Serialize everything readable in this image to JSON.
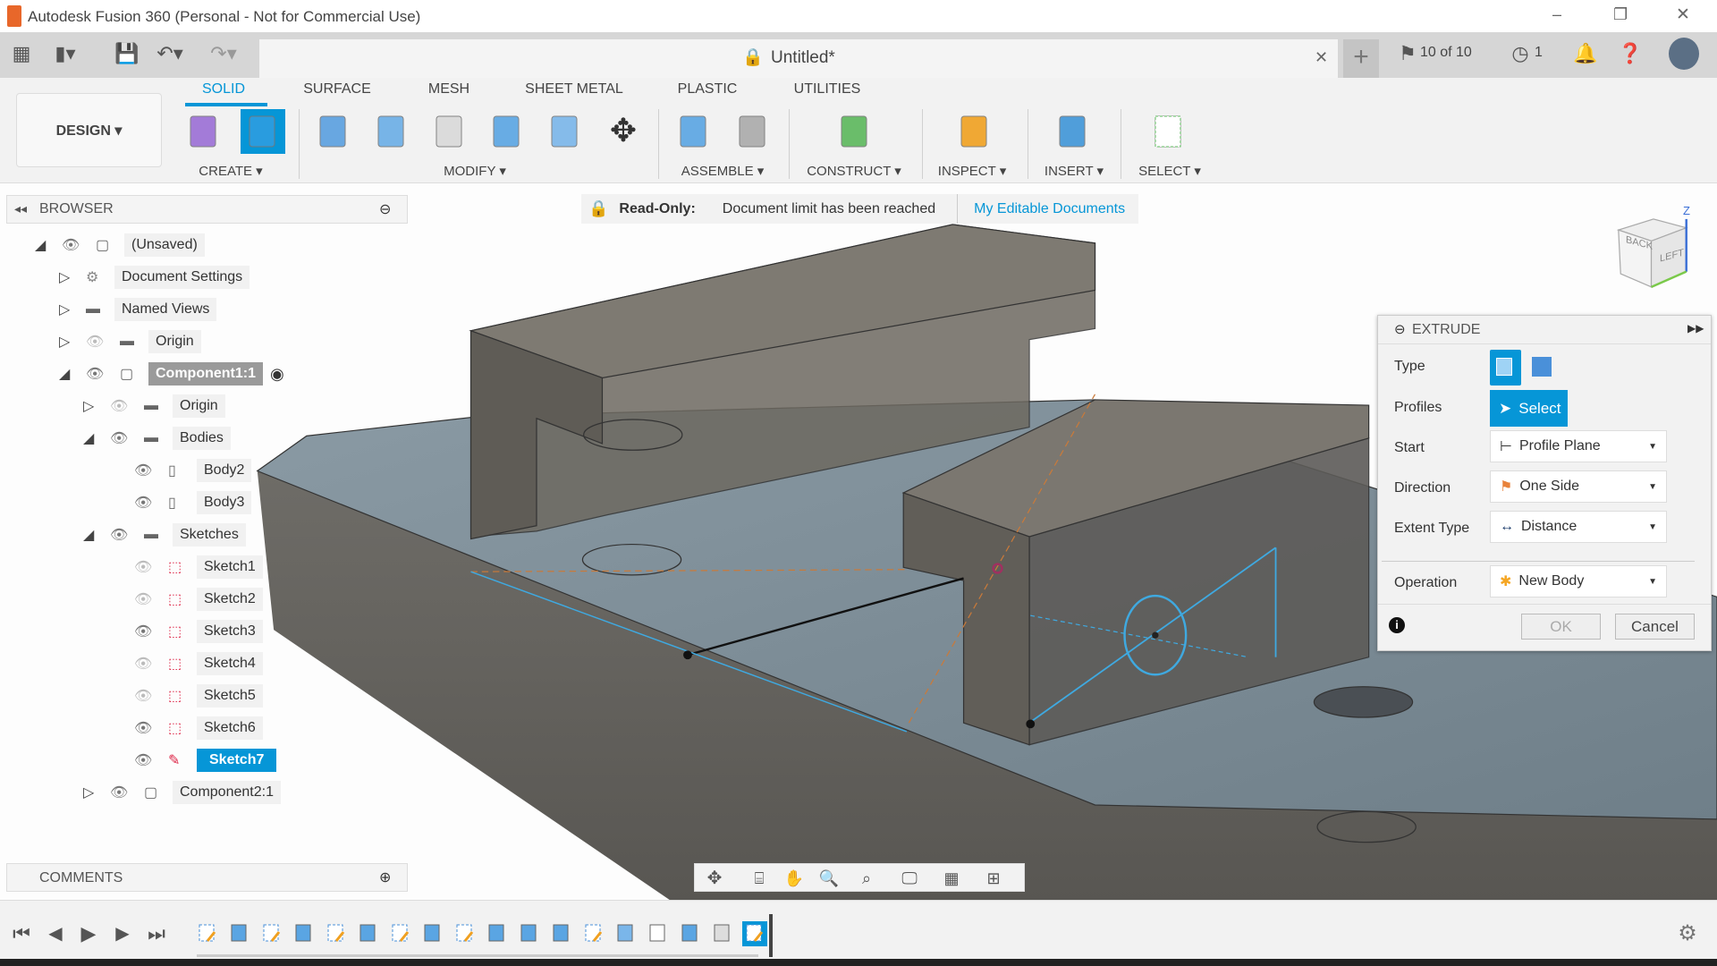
{
  "window": {
    "title": "Autodesk Fusion 360 (Personal - Not for Commercial Use)",
    "minimize": "–",
    "maximize": "❐",
    "close": "✕"
  },
  "tabbar": {
    "doc_title": "Untitled*",
    "close": "✕",
    "plus": "+",
    "jobs": "10 of 10",
    "clock_count": "1"
  },
  "toolbar": {
    "workspace": "DESIGN ▾",
    "tabs": [
      "SOLID",
      "SURFACE",
      "MESH",
      "SHEET METAL",
      "PLASTIC",
      "UTILITIES"
    ],
    "active_tab": "SOLID",
    "groups": [
      "CREATE ▾",
      "MODIFY ▾",
      "ASSEMBLE ▾",
      "CONSTRUCT ▾",
      "INSPECT ▾",
      "INSERT ▾",
      "SELECT ▾"
    ],
    "icons": [
      "create-component-icon",
      "extrude-icon",
      "press-pull-icon",
      "fillet-icon",
      "shell-icon",
      "combine-icon",
      "split-face-icon",
      "move-icon",
      "new-component-icon",
      "joint-icon",
      "offset-plane-icon",
      "measure-icon",
      "insert-image-icon",
      "select-window-icon"
    ]
  },
  "banner": {
    "label": "Read-Only:",
    "message": "Document limit has been reached",
    "link": "My Editable Documents"
  },
  "browser": {
    "title": "BROWSER",
    "items": [
      {
        "label": "(Unsaved)",
        "level": 0,
        "toggle": "open",
        "eye": "on",
        "icon": "document"
      },
      {
        "label": "Document Settings",
        "level": 1,
        "toggle": "closed",
        "eye": "none",
        "icon": "gear"
      },
      {
        "label": "Named Views",
        "level": 1,
        "toggle": "closed",
        "eye": "none",
        "icon": "folder"
      },
      {
        "label": "Origin",
        "level": 1,
        "toggle": "closed",
        "eye": "off",
        "icon": "folder"
      },
      {
        "label": "Component1:1",
        "level": 1,
        "toggle": "open",
        "eye": "on",
        "icon": "component",
        "active": true
      },
      {
        "label": "Origin",
        "level": 2,
        "toggle": "closed",
        "eye": "off",
        "icon": "folder"
      },
      {
        "label": "Bodies",
        "level": 2,
        "toggle": "open",
        "eye": "on",
        "icon": "folder"
      },
      {
        "label": "Body2",
        "level": 3,
        "toggle": "none",
        "eye": "on",
        "icon": "body"
      },
      {
        "label": "Body3",
        "level": 3,
        "toggle": "none",
        "eye": "on",
        "icon": "body"
      },
      {
        "label": "Sketches",
        "level": 2,
        "toggle": "open",
        "eye": "on",
        "icon": "folder"
      },
      {
        "label": "Sketch1",
        "level": 3,
        "toggle": "none",
        "eye": "off",
        "icon": "sketch"
      },
      {
        "label": "Sketch2",
        "level": 3,
        "toggle": "none",
        "eye": "off",
        "icon": "sketch"
      },
      {
        "label": "Sketch3",
        "level": 3,
        "toggle": "none",
        "eye": "on",
        "icon": "sketch"
      },
      {
        "label": "Sketch4",
        "level": 3,
        "toggle": "none",
        "eye": "off",
        "icon": "sketch-locked"
      },
      {
        "label": "Sketch5",
        "level": 3,
        "toggle": "none",
        "eye": "off",
        "icon": "sketch-locked"
      },
      {
        "label": "Sketch6",
        "level": 3,
        "toggle": "none",
        "eye": "on",
        "icon": "sketch-locked"
      },
      {
        "label": "Sketch7",
        "level": 3,
        "toggle": "none",
        "eye": "on",
        "icon": "sketch-edit",
        "selected": true
      },
      {
        "label": "Component2:1",
        "level": 2,
        "toggle": "closed",
        "eye": "on",
        "icon": "component"
      }
    ]
  },
  "comments": {
    "title": "COMMENTS"
  },
  "extrude": {
    "title": "EXTRUDE",
    "fields": [
      {
        "label": "Type"
      },
      {
        "label": "Profiles",
        "value": "Select"
      },
      {
        "label": "Start",
        "value": "Profile Plane"
      },
      {
        "label": "Direction",
        "value": "One Side"
      },
      {
        "label": "Extent Type",
        "value": "Distance"
      },
      {
        "label": "Operation",
        "value": "New Body"
      }
    ],
    "ok": "OK",
    "cancel": "Cancel"
  },
  "viewcube": {
    "faces": [
      "BACK",
      "LEFT"
    ],
    "axis": "Z"
  },
  "timeline": {
    "items": [
      "sketch",
      "extrude",
      "sketch",
      "extrude",
      "sketch",
      "extrude",
      "sketch",
      "extrude",
      "sketch",
      "extrude",
      "extrude",
      "extrude",
      "sketch",
      "move",
      "mirror",
      "extrude",
      "fillet",
      "sketch"
    ],
    "active_index": 17
  },
  "colors": {
    "accent": "#0696d7",
    "selected": "#0696d7",
    "readonly_red": "#d0282e"
  }
}
